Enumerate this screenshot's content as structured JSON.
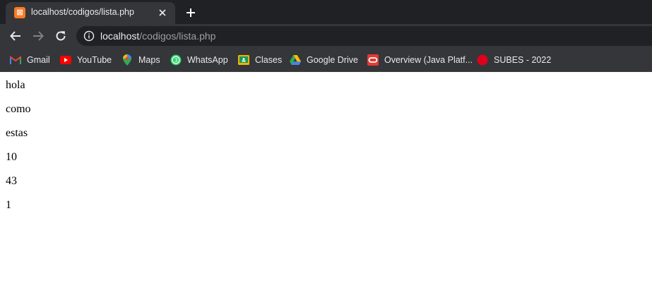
{
  "tab": {
    "title": "localhost/codigos/lista.php"
  },
  "address_bar": {
    "host": "localhost",
    "path": "/codigos/lista.php"
  },
  "bookmarks": [
    {
      "label": "Gmail",
      "icon": "gmail-icon"
    },
    {
      "label": "YouTube",
      "icon": "youtube-icon"
    },
    {
      "label": "Maps",
      "icon": "maps-icon"
    },
    {
      "label": "WhatsApp",
      "icon": "whatsapp-icon"
    },
    {
      "label": "Clases",
      "icon": "classroom-icon"
    },
    {
      "label": "Google Drive",
      "icon": "drive-icon"
    },
    {
      "label": "Overview (Java Platf...",
      "icon": "oracle-icon"
    },
    {
      "label": "SUBES - 2022",
      "icon": "red-dot-icon"
    }
  ],
  "page": {
    "lines": [
      "hola",
      "como",
      "estas",
      "10",
      "43",
      "1"
    ]
  },
  "colors": {
    "tabstrip": "#202124",
    "toolbar": "#35363a",
    "favicon": "#fb7a24",
    "text_light": "#e8eaed",
    "text_dim": "#9aa0a6"
  }
}
